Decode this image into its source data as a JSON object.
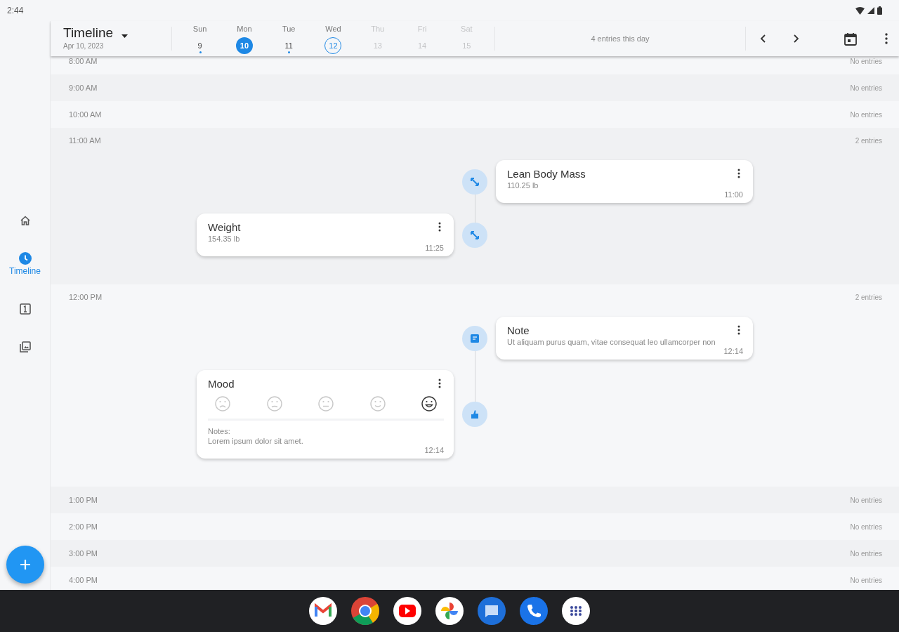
{
  "status_bar": {
    "time": "2:44"
  },
  "nav_rail": [
    {
      "selected": false
    },
    {
      "selected": true,
      "label": "Timeline"
    },
    {
      "selected": false
    },
    {
      "selected": false
    }
  ],
  "header": {
    "title": "Timeline",
    "subtitle": "Apr 10, 2023",
    "summary": "4 entries this day"
  },
  "week": [
    {
      "weekday": "Sun",
      "day": "9",
      "selected": false,
      "today": false,
      "has_entries": true,
      "disabled": false
    },
    {
      "weekday": "Mon",
      "day": "10",
      "selected": true,
      "today": false,
      "has_entries": false,
      "disabled": false
    },
    {
      "weekday": "Tue",
      "day": "11",
      "selected": false,
      "today": false,
      "has_entries": true,
      "disabled": false
    },
    {
      "weekday": "Wed",
      "day": "12",
      "selected": false,
      "today": true,
      "has_entries": false,
      "disabled": false
    },
    {
      "weekday": "Thu",
      "day": "13",
      "selected": false,
      "today": false,
      "has_entries": false,
      "disabled": true
    },
    {
      "weekday": "Fri",
      "day": "14",
      "selected": false,
      "today": false,
      "has_entries": false,
      "disabled": true
    },
    {
      "weekday": "Sat",
      "day": "15",
      "selected": false,
      "today": false,
      "has_entries": false,
      "disabled": true
    }
  ],
  "hours": [
    {
      "label": "8:00 AM",
      "summary": "No entries"
    },
    {
      "label": "9:00 AM",
      "summary": "No entries"
    },
    {
      "label": "10:00 AM",
      "summary": "No entries"
    },
    {
      "label": "11:00 AM",
      "summary": "2 entries",
      "entries": [
        {
          "kind": "measurement",
          "title": "Lean Body Mass",
          "value": "110.25 lb",
          "time": "11:00"
        },
        {
          "kind": "measurement",
          "title": "Weight",
          "value": "154.35 lb",
          "time": "11:25"
        }
      ]
    },
    {
      "label": "12:00 PM",
      "summary": "2 entries",
      "entries": [
        {
          "kind": "note",
          "title": "Note",
          "value": "Ut aliquam purus quam, vitae consequat leo ullamcorper non",
          "time": "12:14"
        },
        {
          "kind": "mood",
          "title": "Mood",
          "faces": [
            {
              "selected": false
            },
            {
              "selected": false
            },
            {
              "selected": false
            },
            {
              "selected": false
            },
            {
              "selected": true
            }
          ],
          "notes_label": "Notes:",
          "value": "Lorem ipsum dolor sit amet.",
          "time": "12:14"
        }
      ]
    },
    {
      "label": "1:00 PM",
      "summary": "No entries"
    },
    {
      "label": "2:00 PM",
      "summary": "No entries"
    },
    {
      "label": "3:00 PM",
      "summary": "No entries"
    },
    {
      "label": "4:00 PM",
      "summary": "No entries"
    }
  ]
}
